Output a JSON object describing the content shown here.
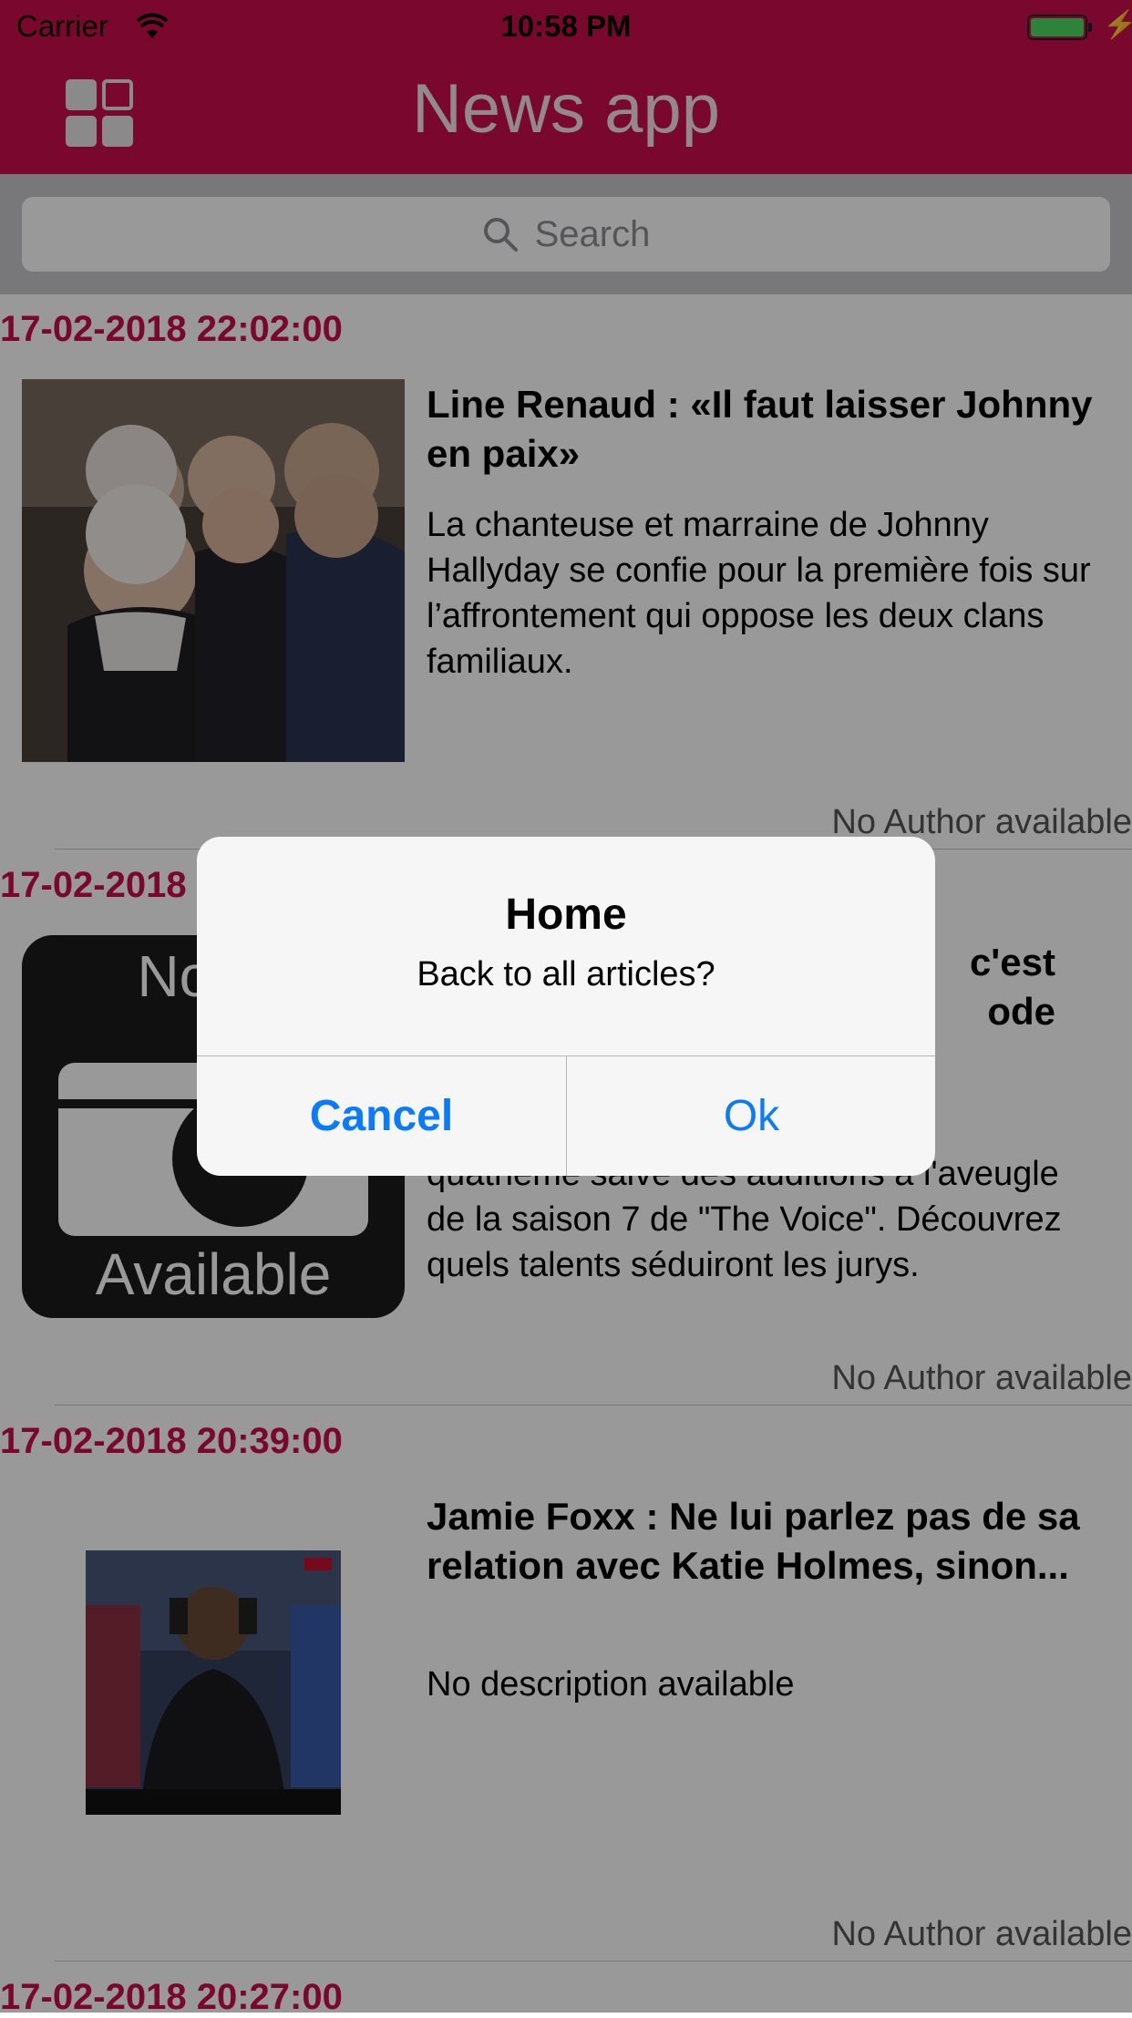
{
  "status_bar": {
    "carrier": "Carrier",
    "time": "10:58 PM"
  },
  "nav": {
    "title": "News app",
    "menu_icon": "grid-menu-icon"
  },
  "search": {
    "placeholder": "Search"
  },
  "articles": [
    {
      "date": "17-02-2018 22:02:00",
      "title": "Line Renaud : «Il faut laisser Johnny en paix»",
      "description": "La chanteuse et marraine de Johnny Hallyday se confie pour la première fois sur l’affrontement qui oppose les deux clans familiaux.",
      "author": "No Author available"
    },
    {
      "date": "17-02-2018",
      "title_visible": "c'est\node",
      "description_visible": "quatrième salve des auditions à l'aveugle de la saison 7 de \"The Voice\". Découvrez quels talents séduiront les jurys.",
      "image_text_top": "No im",
      "image_text_bottom": "Available",
      "author": "No Author available"
    },
    {
      "date": "17-02-2018 20:39:00",
      "title": "Jamie Foxx : Ne lui parlez pas de sa relation avec Katie Holmes, sinon...",
      "description": "No description available",
      "author": "No Author available"
    },
    {
      "date": "17-02-2018 20:27:00"
    }
  ],
  "alert": {
    "title": "Home",
    "message": "Back to all articles?",
    "cancel_label": "Cancel",
    "ok_label": "Ok"
  },
  "colors": {
    "brand": "#cc0d4c",
    "link": "#0a7aff"
  }
}
